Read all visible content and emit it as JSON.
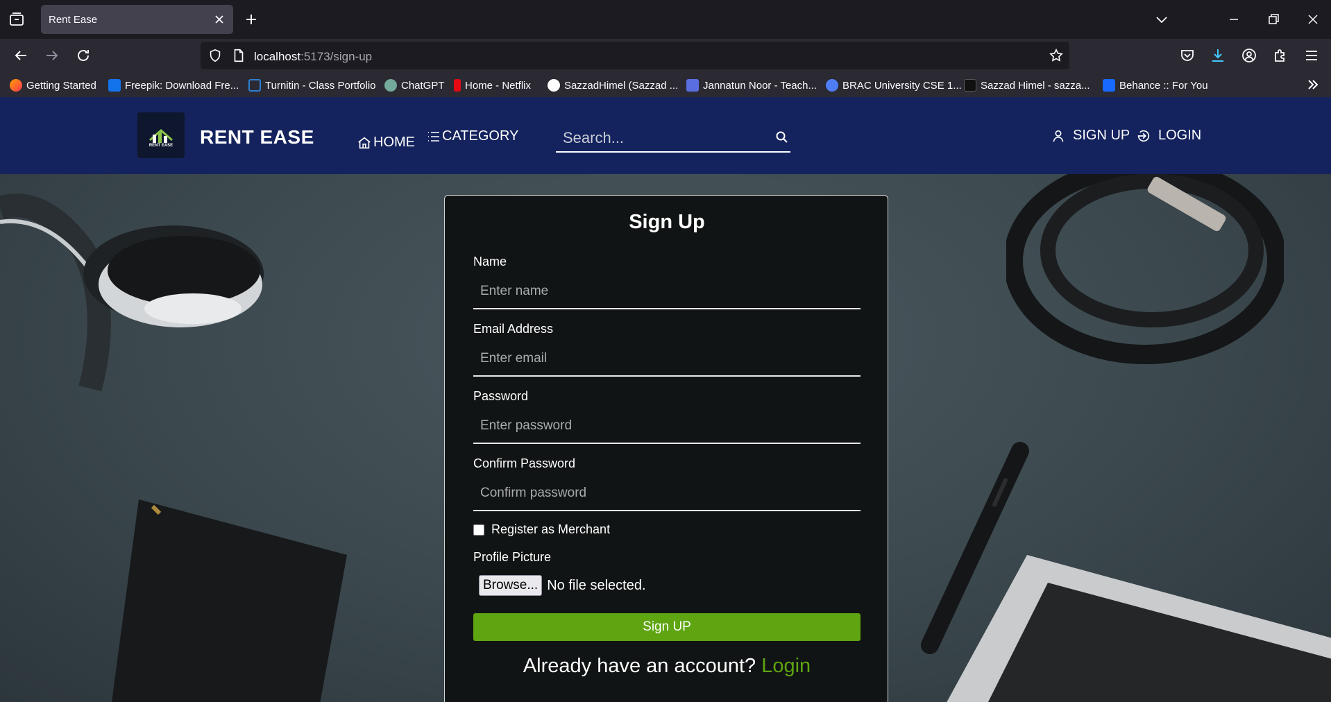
{
  "browser": {
    "tab_title": "Rent Ease",
    "url_host": "localhost",
    "url_rest": ":5173/sign-up",
    "bookmarks": [
      {
        "label": "Getting Started",
        "color": "#ff7139"
      },
      {
        "label": "Freepik: Download Fre...",
        "color": "#1273eb"
      },
      {
        "label": "Turnitin - Class Portfolio",
        "color": "#2d7fd3"
      },
      {
        "label": "ChatGPT",
        "color": "#74aa9c"
      },
      {
        "label": "Home - Netflix",
        "color": "#e50914"
      },
      {
        "label": "SazzadHimel (Sazzad ...",
        "color": "#ffffff"
      },
      {
        "label": "Jannatun Noor - Teach...",
        "color": "#5b6ee1"
      },
      {
        "label": "BRAC University CSE 1...",
        "color": "#4f7df3"
      },
      {
        "label": "Sazzad Himel - sazza...",
        "color": "#111111"
      },
      {
        "label": "Behance :: For You",
        "color": "#1769ff"
      }
    ]
  },
  "header": {
    "brand": "RENT EASE",
    "logo_text": "RENT EASE",
    "home": "HOME",
    "category": "CATEGORY",
    "search_placeholder": "Search...",
    "sign_up": "SIGN UP",
    "login": "LOGIN"
  },
  "form": {
    "title": "Sign Up",
    "name_label": "Name",
    "name_placeholder": "Enter name",
    "email_label": "Email Address",
    "email_placeholder": "Enter email",
    "password_label": "Password",
    "password_placeholder": "Enter password",
    "confirm_label": "Confirm Password",
    "confirm_placeholder": "Confirm password",
    "merchant_label": "Register as Merchant",
    "picture_label": "Profile Picture",
    "browse_label": "Browse...",
    "file_status": "No file selected.",
    "submit_label": "Sign UP",
    "already_text": "Already have an account?",
    "login_link": "Login"
  },
  "colors": {
    "header_bg": "#14235d",
    "accent_green": "#5ea511",
    "card_bg": "#111414"
  }
}
